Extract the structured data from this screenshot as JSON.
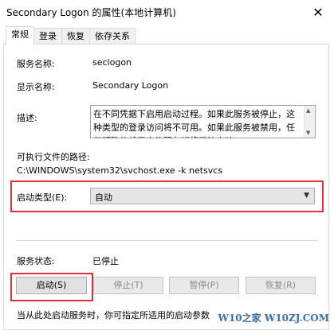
{
  "window": {
    "title": "Secondary Logon 的属性(本地计算机)"
  },
  "tabs": [
    {
      "label": "常规"
    },
    {
      "label": "登录"
    },
    {
      "label": "恢复"
    },
    {
      "label": "依存关系"
    }
  ],
  "general": {
    "service_name_label": "服务名称:",
    "service_name_value": "seclogon",
    "display_name_label": "显示名称:",
    "display_name_value": "Secondary Logon",
    "description_label": "描述:",
    "description_text": "在不同凭据下启用启动过程。如果此服务被停止，这种类型的登录访问将不可用。如果此服务被禁用，任何明确依赖于它的服务都将无法启动。",
    "exe_path_label": "可执行文件的路径:",
    "exe_path_value": "C:\\WINDOWS\\system32\\svchost.exe -k netsvcs",
    "startup_type_label": "启动类型(E):",
    "startup_type_value": "自动",
    "service_status_label": "服务状态:",
    "service_status_value": "已停止",
    "hint_text": "当从此处启动服务时，你可指定所适用的启动参数"
  },
  "buttons": {
    "start": "启动(S)",
    "stop": "停止(T)",
    "pause": "暂停(P)",
    "resume": "恢复(R)"
  },
  "watermark": "W10之家 W10ZJ.COM",
  "colors": {
    "highlight": "#d9333f",
    "watermark": "#3a6fa8"
  }
}
